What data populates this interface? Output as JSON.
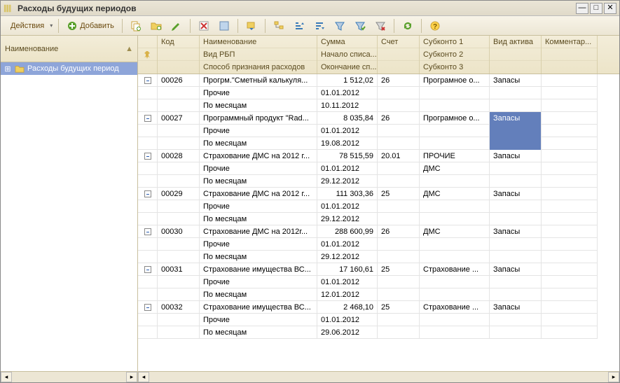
{
  "window": {
    "title": "Расходы будущих периодов"
  },
  "toolbar": {
    "actions_label": "Действия",
    "add_label": "Добавить"
  },
  "tree": {
    "header": "Наименование",
    "root_label": "Расходы будущих период"
  },
  "grid": {
    "headers": {
      "code": "Код",
      "name": [
        "Наименование",
        "Вид РБП",
        "Способ признания расходов"
      ],
      "sum": [
        "Сумма",
        "Начало списа...",
        "Окончание сп..."
      ],
      "account": "Счет",
      "sub": [
        "Субконто 1",
        "Субконто 2",
        "Субконто 3"
      ],
      "asset": "Вид актива",
      "comment": "Комментар..."
    },
    "rows": [
      {
        "code": "00026",
        "name": "Прогрм.\"Сметный калькуля...",
        "type": "Прочие",
        "method": "По месяцам",
        "sum": "1 512,02",
        "start": "01.01.2012",
        "end": "10.11.2012",
        "acct": "26",
        "sub1": "Програмное о...",
        "sub2": "",
        "sub3": "",
        "asset": "Запасы",
        "comment": ""
      },
      {
        "code": "00027",
        "name": "Программный продукт \"Rad...",
        "type": "Прочие",
        "method": "По месяцам",
        "sum": "8 035,84",
        "start": "01.01.2012",
        "end": "19.08.2012",
        "acct": "26",
        "sub1": "Програмное о...",
        "sub2": "",
        "sub3": "",
        "asset": "Запасы",
        "comment": "",
        "selected": true
      },
      {
        "code": "00028",
        "name": "Страхование ДМС на 2012 г...",
        "type": "Прочие",
        "method": "По месяцам",
        "sum": "78 515,59",
        "start": "01.01.2012",
        "end": "29.12.2012",
        "acct": "20.01",
        "sub1": "ПРОЧИЕ",
        "sub2": "ДМС",
        "sub3": "",
        "asset": "Запасы",
        "comment": ""
      },
      {
        "code": "00029",
        "name": "Страхование ДМС на 2012 г...",
        "type": "Прочие",
        "method": "По месяцам",
        "sum": "111 303,36",
        "start": "01.01.2012",
        "end": "29.12.2012",
        "acct": "25",
        "sub1": "ДМС",
        "sub2": "",
        "sub3": "",
        "asset": "Запасы",
        "comment": ""
      },
      {
        "code": "00030",
        "name": "Страхование ДМС на 2012г...",
        "type": "Прочие",
        "method": "По месяцам",
        "sum": "288 600,99",
        "start": "01.01.2012",
        "end": "29.12.2012",
        "acct": "26",
        "sub1": "ДМС",
        "sub2": "",
        "sub3": "",
        "asset": "Запасы",
        "comment": ""
      },
      {
        "code": "00031",
        "name": "Страхование имущества ВС...",
        "type": "Прочие",
        "method": "По месяцам",
        "sum": "17 160,61",
        "start": "01.01.2012",
        "end": "12.01.2012",
        "acct": "25",
        "sub1": "Страхование ...",
        "sub2": "",
        "sub3": "",
        "asset": "Запасы",
        "comment": ""
      },
      {
        "code": "00032",
        "name": "Страхование имущества ВС...",
        "type": "Прочие",
        "method": "По месяцам",
        "sum": "2 468,10",
        "start": "01.01.2012",
        "end": "29.06.2012",
        "acct": "25",
        "sub1": "Страхование ...",
        "sub2": "",
        "sub3": "",
        "asset": "Запасы",
        "comment": ""
      }
    ]
  },
  "icons": {
    "add": "plus-green",
    "copy": "page-plus",
    "addgroup": "folder-plus",
    "edit": "pencil",
    "delete": "red-x",
    "save": "disk",
    "swap": "swap",
    "sort": "sort",
    "filter1": "funnel1",
    "filter2": "funnel2",
    "filter3": "funnel3",
    "filteroff": "funnel-clear",
    "refresh": "refresh",
    "help": "help"
  }
}
